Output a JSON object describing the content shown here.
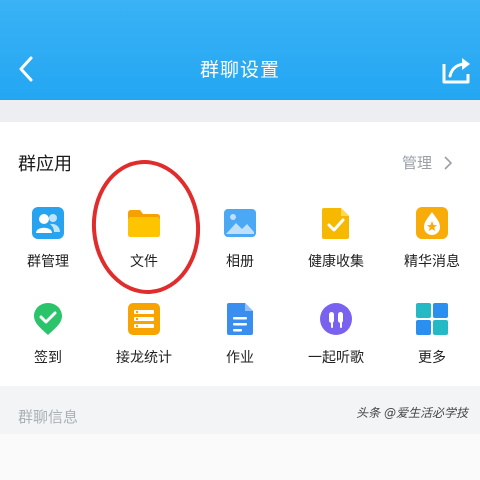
{
  "header": {
    "title": "群聊设置"
  },
  "group_apps": {
    "title": "群应用",
    "manage_label": "管理",
    "items": [
      {
        "label": "群管理",
        "icon": "group-admin-icon"
      },
      {
        "label": "文件",
        "icon": "folder-icon"
      },
      {
        "label": "相册",
        "icon": "photo-album-icon"
      },
      {
        "label": "健康收集",
        "icon": "health-collect-icon"
      },
      {
        "label": "精华消息",
        "icon": "essence-message-icon"
      },
      {
        "label": "签到",
        "icon": "checkin-icon"
      },
      {
        "label": "接龙统计",
        "icon": "relay-stats-icon"
      },
      {
        "label": "作业",
        "icon": "homework-icon"
      },
      {
        "label": "一起听歌",
        "icon": "listen-together-icon"
      },
      {
        "label": "更多",
        "icon": "more-apps-icon"
      }
    ]
  },
  "group_info": {
    "label": "群聊信息"
  },
  "watermark": "头条 @爱生活必学技",
  "colors": {
    "header": "#29a9f3",
    "annotation_circle": "#e12c2c"
  }
}
